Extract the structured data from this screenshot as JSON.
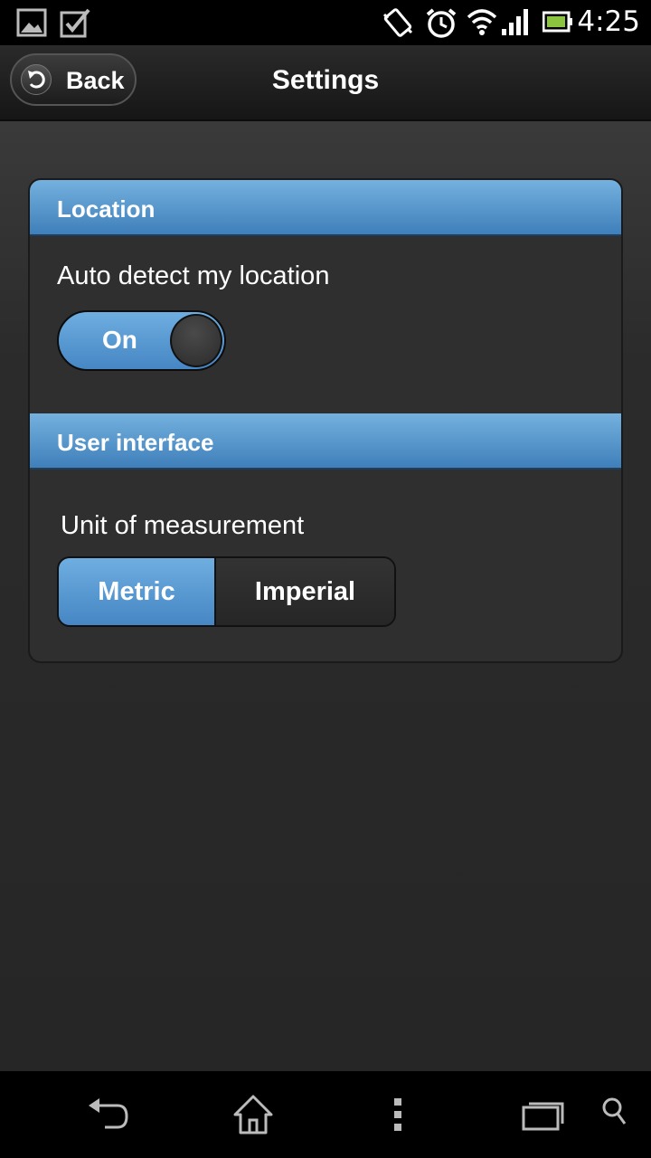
{
  "status_bar": {
    "icons": [
      "image-icon",
      "checkbox-icon",
      "vibrate-icon",
      "alarm-icon",
      "wifi-icon",
      "signal-icon",
      "battery-icon"
    ],
    "time": "4:25"
  },
  "header": {
    "back_label": "Back",
    "title": "Settings"
  },
  "sections": {
    "location": {
      "title": "Location",
      "auto_detect_label": "Auto detect my location",
      "toggle_state": "On"
    },
    "user_interface": {
      "title": "User interface",
      "unit_label": "Unit of measurement",
      "options": [
        "Metric",
        "Imperial"
      ],
      "selected": "Metric"
    }
  },
  "nav_bar": {
    "icons": [
      "back-icon",
      "home-icon",
      "menu-icon",
      "recents-icon",
      "search-icon"
    ]
  },
  "colors": {
    "accent": "#5a9bd4",
    "background": "#2b2b2b",
    "bar": "#000000"
  }
}
